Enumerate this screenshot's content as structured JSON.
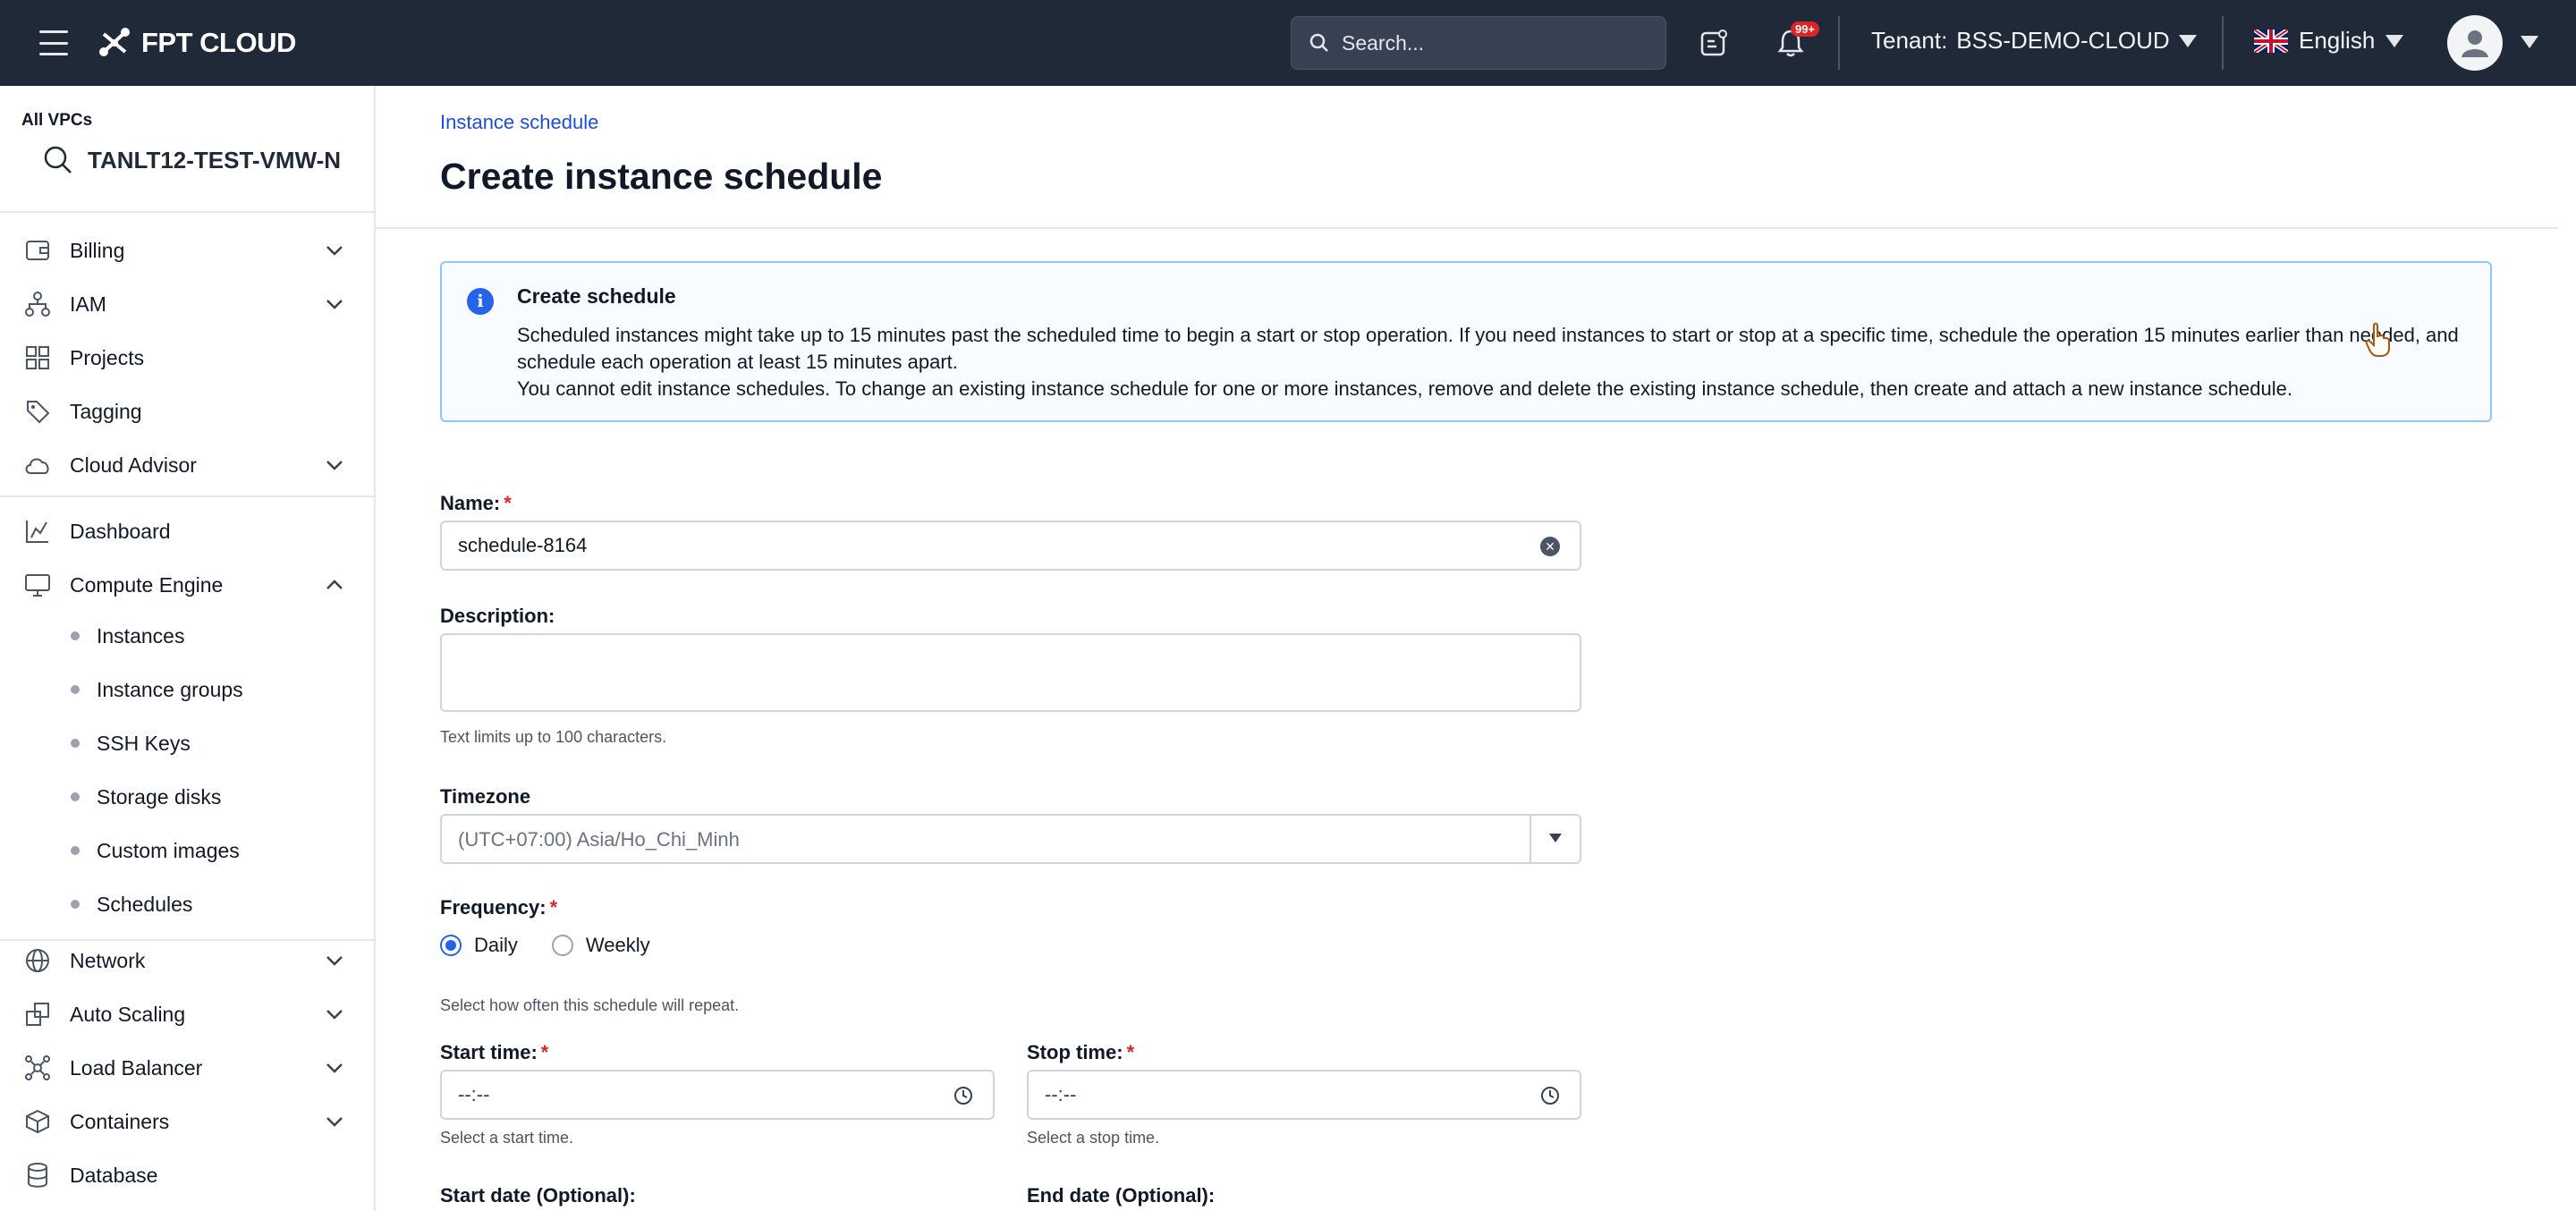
{
  "topbar": {
    "logo_text": "FPT CLOUD",
    "search_placeholder": "Search...",
    "notification_badge": "99+",
    "tenant_label": "Tenant:",
    "tenant_value": "BSS-DEMO-CLOUD",
    "language": "English"
  },
  "sidebar": {
    "vpc_label": "All VPCs",
    "vpc_value": "TANLT12-TEST-VMW-N",
    "items": [
      {
        "label": "Billing",
        "icon": "wallet-icon",
        "expanded": false
      },
      {
        "label": "IAM",
        "icon": "org-chart-icon",
        "expanded": false
      },
      {
        "label": "Projects",
        "icon": "grid-icon"
      },
      {
        "label": "Tagging",
        "icon": "tag-icon"
      },
      {
        "label": "Cloud Advisor",
        "icon": "cloud-icon",
        "expanded": false
      },
      {
        "label": "Dashboard",
        "icon": "chart-line-icon"
      },
      {
        "label": "Compute Engine",
        "icon": "monitor-icon",
        "expanded": true
      },
      {
        "label": "Network",
        "icon": "globe-icon",
        "expanded": false
      },
      {
        "label": "Auto Scaling",
        "icon": "scaling-icon",
        "expanded": false
      },
      {
        "label": "Load Balancer",
        "icon": "network-node-icon",
        "expanded": false
      },
      {
        "label": "Containers",
        "icon": "box-icon",
        "expanded": false
      },
      {
        "label": "Database",
        "icon": "database-icon"
      }
    ],
    "compute_sub": [
      {
        "label": "Instances"
      },
      {
        "label": "Instance groups"
      },
      {
        "label": "SSH Keys"
      },
      {
        "label": "Storage disks"
      },
      {
        "label": "Custom images"
      },
      {
        "label": "Schedules"
      }
    ]
  },
  "main": {
    "breadcrumb": "Instance schedule",
    "title": "Create instance schedule",
    "info": {
      "title": "Create schedule",
      "line1": "Scheduled instances might take up to 15 minutes past the scheduled time to begin a start or stop operation. If you need instances to start or stop at a specific time, schedule the operation 15 minutes earlier than needed, and schedule each operation at least 15 minutes apart.",
      "line2": "You cannot edit instance schedules. To change an existing instance schedule for one or more instances, remove and delete the existing instance schedule, then create and attach a new instance schedule."
    },
    "form": {
      "name_label": "Name:",
      "name_value": "schedule-8164",
      "description_label": "Description:",
      "description_value": "",
      "description_hint": "Text limits up to 100 characters.",
      "timezone_label": "Timezone",
      "timezone_value": "(UTC+07:00) Asia/Ho_Chi_Minh",
      "frequency_label": "Frequency:",
      "frequency_options": [
        "Daily",
        "Weekly"
      ],
      "frequency_selected": "Daily",
      "frequency_hint": "Select how often this schedule will repeat.",
      "start_time_label": "Start time:",
      "start_time_value": "--:--",
      "start_time_hint": "Select a start time.",
      "stop_time_label": "Stop time:",
      "stop_time_value": "--:--",
      "stop_time_hint": "Select a stop time.",
      "start_date_label": "Start date (Optional):",
      "end_date_label": "End date (Optional):"
    }
  },
  "colors": {
    "topbar_bg": "#1f2937",
    "accent": "#2563eb",
    "required": "#dc2626",
    "link": "#1d4ed8"
  }
}
